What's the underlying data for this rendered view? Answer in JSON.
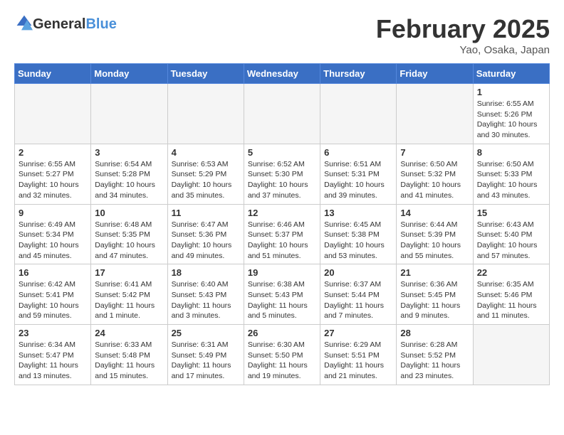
{
  "logo": {
    "general": "General",
    "blue": "Blue"
  },
  "header": {
    "month": "February 2025",
    "location": "Yao, Osaka, Japan"
  },
  "weekdays": [
    "Sunday",
    "Monday",
    "Tuesday",
    "Wednesday",
    "Thursday",
    "Friday",
    "Saturday"
  ],
  "weeks": [
    [
      {
        "day": "",
        "info": ""
      },
      {
        "day": "",
        "info": ""
      },
      {
        "day": "",
        "info": ""
      },
      {
        "day": "",
        "info": ""
      },
      {
        "day": "",
        "info": ""
      },
      {
        "day": "",
        "info": ""
      },
      {
        "day": "1",
        "info": "Sunrise: 6:55 AM\nSunset: 5:26 PM\nDaylight: 10 hours and 30 minutes."
      }
    ],
    [
      {
        "day": "2",
        "info": "Sunrise: 6:55 AM\nSunset: 5:27 PM\nDaylight: 10 hours and 32 minutes."
      },
      {
        "day": "3",
        "info": "Sunrise: 6:54 AM\nSunset: 5:28 PM\nDaylight: 10 hours and 34 minutes."
      },
      {
        "day": "4",
        "info": "Sunrise: 6:53 AM\nSunset: 5:29 PM\nDaylight: 10 hours and 35 minutes."
      },
      {
        "day": "5",
        "info": "Sunrise: 6:52 AM\nSunset: 5:30 PM\nDaylight: 10 hours and 37 minutes."
      },
      {
        "day": "6",
        "info": "Sunrise: 6:51 AM\nSunset: 5:31 PM\nDaylight: 10 hours and 39 minutes."
      },
      {
        "day": "7",
        "info": "Sunrise: 6:50 AM\nSunset: 5:32 PM\nDaylight: 10 hours and 41 minutes."
      },
      {
        "day": "8",
        "info": "Sunrise: 6:50 AM\nSunset: 5:33 PM\nDaylight: 10 hours and 43 minutes."
      }
    ],
    [
      {
        "day": "9",
        "info": "Sunrise: 6:49 AM\nSunset: 5:34 PM\nDaylight: 10 hours and 45 minutes."
      },
      {
        "day": "10",
        "info": "Sunrise: 6:48 AM\nSunset: 5:35 PM\nDaylight: 10 hours and 47 minutes."
      },
      {
        "day": "11",
        "info": "Sunrise: 6:47 AM\nSunset: 5:36 PM\nDaylight: 10 hours and 49 minutes."
      },
      {
        "day": "12",
        "info": "Sunrise: 6:46 AM\nSunset: 5:37 PM\nDaylight: 10 hours and 51 minutes."
      },
      {
        "day": "13",
        "info": "Sunrise: 6:45 AM\nSunset: 5:38 PM\nDaylight: 10 hours and 53 minutes."
      },
      {
        "day": "14",
        "info": "Sunrise: 6:44 AM\nSunset: 5:39 PM\nDaylight: 10 hours and 55 minutes."
      },
      {
        "day": "15",
        "info": "Sunrise: 6:43 AM\nSunset: 5:40 PM\nDaylight: 10 hours and 57 minutes."
      }
    ],
    [
      {
        "day": "16",
        "info": "Sunrise: 6:42 AM\nSunset: 5:41 PM\nDaylight: 10 hours and 59 minutes."
      },
      {
        "day": "17",
        "info": "Sunrise: 6:41 AM\nSunset: 5:42 PM\nDaylight: 11 hours and 1 minute."
      },
      {
        "day": "18",
        "info": "Sunrise: 6:40 AM\nSunset: 5:43 PM\nDaylight: 11 hours and 3 minutes."
      },
      {
        "day": "19",
        "info": "Sunrise: 6:38 AM\nSunset: 5:43 PM\nDaylight: 11 hours and 5 minutes."
      },
      {
        "day": "20",
        "info": "Sunrise: 6:37 AM\nSunset: 5:44 PM\nDaylight: 11 hours and 7 minutes."
      },
      {
        "day": "21",
        "info": "Sunrise: 6:36 AM\nSunset: 5:45 PM\nDaylight: 11 hours and 9 minutes."
      },
      {
        "day": "22",
        "info": "Sunrise: 6:35 AM\nSunset: 5:46 PM\nDaylight: 11 hours and 11 minutes."
      }
    ],
    [
      {
        "day": "23",
        "info": "Sunrise: 6:34 AM\nSunset: 5:47 PM\nDaylight: 11 hours and 13 minutes."
      },
      {
        "day": "24",
        "info": "Sunrise: 6:33 AM\nSunset: 5:48 PM\nDaylight: 11 hours and 15 minutes."
      },
      {
        "day": "25",
        "info": "Sunrise: 6:31 AM\nSunset: 5:49 PM\nDaylight: 11 hours and 17 minutes."
      },
      {
        "day": "26",
        "info": "Sunrise: 6:30 AM\nSunset: 5:50 PM\nDaylight: 11 hours and 19 minutes."
      },
      {
        "day": "27",
        "info": "Sunrise: 6:29 AM\nSunset: 5:51 PM\nDaylight: 11 hours and 21 minutes."
      },
      {
        "day": "28",
        "info": "Sunrise: 6:28 AM\nSunset: 5:52 PM\nDaylight: 11 hours and 23 minutes."
      },
      {
        "day": "",
        "info": ""
      }
    ]
  ]
}
